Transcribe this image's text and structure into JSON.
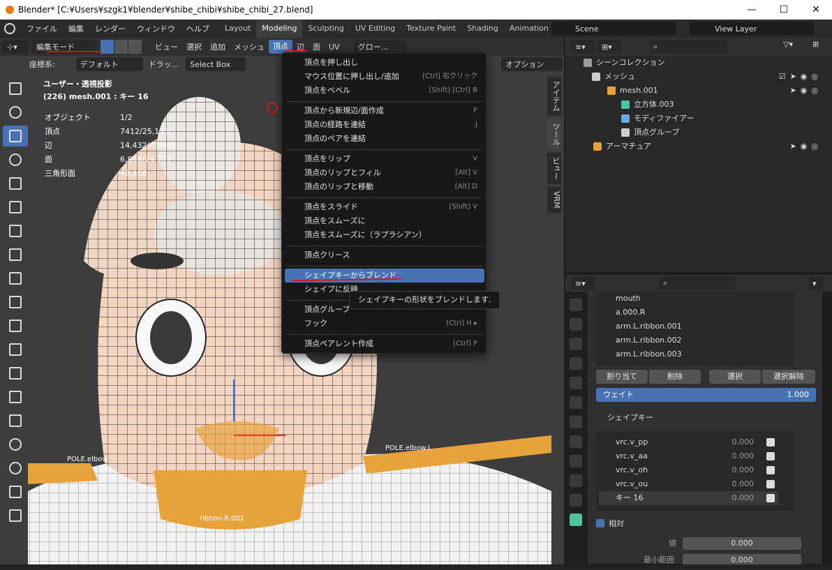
{
  "window": {
    "title": "Blender* [C:¥Users¥szgk1¥blender¥shibe_chibi¥shibe_chibi_27.blend]",
    "controls": [
      "—",
      "☐",
      "✕"
    ]
  },
  "menubar": {
    "items": [
      "ファイル",
      "編集",
      "レンダー",
      "ウィンドウ",
      "ヘルプ"
    ],
    "workspaces": [
      "Layout",
      "Modeling",
      "Sculpting",
      "UV Editing",
      "Texture Paint",
      "Shading",
      "Animation"
    ],
    "active_workspace": "Modeling",
    "scene": "Scene",
    "view_layer": "View Layer"
  },
  "viewport_header": {
    "mode": "編集モード",
    "menus": [
      "ビュー",
      "選択",
      "追加",
      "メッシュ",
      "頂点",
      "辺",
      "面",
      "UV"
    ],
    "active_menu": "頂点",
    "pivot": "グロー...",
    "coord_label": "座標系:",
    "coord_value": "デフォルト",
    "drag_label": "ドラッ...",
    "select_box": "Select Box",
    "options": "オプション"
  },
  "viewport": {
    "view_name": "ユーザー・透視投影",
    "object_line": "(226) mesh.001 : キー 16",
    "stats": [
      {
        "label": "オブジェクト",
        "value": "1/2"
      },
      {
        "label": "頂点",
        "value": "7412/25,155"
      },
      {
        "label": "辺",
        "value": "14,432/49,496"
      },
      {
        "label": "面",
        "value": "6,858/24,777"
      },
      {
        "label": "三角形面",
        "value": "49,468"
      }
    ],
    "side_tabs": [
      "アイテム",
      "ツール",
      "ビュー",
      "VRM"
    ],
    "labels": [
      "POLE.elbow.L",
      "POLE.elbow",
      "ribbon.R.001"
    ]
  },
  "vertex_menu": {
    "items": [
      {
        "label": "頂点を押し出し",
        "shortcut": ""
      },
      {
        "label": "マウス位置に押し出し/追加",
        "shortcut": "[Ctrl] 右クリック"
      },
      {
        "label": "頂点をベベル",
        "shortcut": "[Shift] [Ctrl] B"
      },
      {
        "label": "頂点から新規辺/面作成",
        "shortcut": "F"
      },
      {
        "label": "頂点の経路を連結",
        "shortcut": "J"
      },
      {
        "label": "頂点のペアを連結",
        "shortcut": ""
      },
      {
        "label": "頂点をリップ",
        "shortcut": "V"
      },
      {
        "label": "頂点のリップとフィル",
        "shortcut": "[Alt] V"
      },
      {
        "label": "頂点のリップと移動",
        "shortcut": "[Alt] D"
      },
      {
        "label": "頂点をスライド",
        "shortcut": "[Shift] V"
      },
      {
        "label": "頂点をスムーズに",
        "shortcut": ""
      },
      {
        "label": "頂点をスムーズに（ラプラシアン）",
        "shortcut": ""
      },
      {
        "label": "頂点クリース",
        "shortcut": ""
      },
      {
        "label": "シェイプキーからブレンド",
        "shortcut": ""
      },
      {
        "label": "シェイプに反映",
        "shortcut": ""
      },
      {
        "label": "頂点グループ",
        "shortcut": ""
      },
      {
        "label": "フック",
        "shortcut": "[Ctrl] H ▸"
      },
      {
        "label": "頂点ペアレント作成",
        "shortcut": "[Ctrl] P"
      }
    ],
    "tooltip": "シェイプキーの形状をブレンドします."
  },
  "outliner": {
    "title": "シーンコレクション",
    "rows": [
      {
        "label": "メッシュ",
        "color": "#cfcfcf"
      },
      {
        "label": "mesh.001",
        "color": "#e8a23a"
      },
      {
        "label": "立方体.003",
        "color": "#4fc1a3"
      },
      {
        "label": "モディファイアー",
        "color": "#6fa8dc"
      },
      {
        "label": "頂点グループ",
        "color": "#cfcfcf"
      },
      {
        "label": "アーマチュア",
        "color": "#e8a23a"
      }
    ]
  },
  "properties": {
    "vertex_groups": [
      "mouth",
      "a.000.R",
      "arm.L.ribbon.001",
      "arm.L.ribbon.002",
      "arm.L.ribbon.003"
    ],
    "buttons": [
      "割り当て",
      "削除",
      "選択",
      "選択解除"
    ],
    "weight_label": "ウェイト",
    "weight_value": "1.000",
    "shapekeys_title": "シェイプキー",
    "shapekeys": [
      {
        "name": "vrc.v_pp",
        "value": "0.000"
      },
      {
        "name": "vrc.v_aa",
        "value": "0.000"
      },
      {
        "name": "vrc.v_oh",
        "value": "0.000"
      },
      {
        "name": "vrc.v_ou",
        "value": "0.000"
      },
      {
        "name": "キー 16",
        "value": "0.000"
      }
    ],
    "relative_label": "相対",
    "value_label": "値",
    "value": "0.000",
    "min_label": "最小範囲",
    "min_value": "0.000"
  }
}
